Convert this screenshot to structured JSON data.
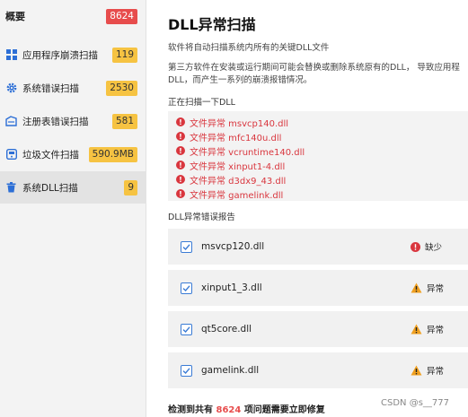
{
  "sidebar": {
    "items": [
      {
        "label": "概要",
        "badge": "8624",
        "icon": "none"
      },
      {
        "label": "应用程序崩溃扫描",
        "badge": "119",
        "icon": "app-grid-icon"
      },
      {
        "label": "系统错误扫描",
        "badge": "2530",
        "icon": "gear-icon"
      },
      {
        "label": "注册表错误扫描",
        "badge": "581",
        "icon": "registry-icon"
      },
      {
        "label": "垃圾文件扫描",
        "badge": "590.9MB",
        "icon": "disk-icon"
      },
      {
        "label": "系统DLL扫描",
        "badge": "9",
        "icon": "trash-icon"
      }
    ]
  },
  "main": {
    "title": "DLL异常扫描",
    "desc_line1": "软件将自动扫描系统内所有的关键DLL文件",
    "desc_line2": "第三方软件在安装或运行期间可能会替换或删除系统原有的DLL， 导致应用程",
    "desc_line3": "DLL，而产生一系列的崩溃报错情况。",
    "scanning_label": "正在扫描一下DLL",
    "scan_items": [
      "文件异常 msvcp140.dll",
      "文件异常 mfc140u.dll",
      "文件异常 vcruntime140.dll",
      "文件异常 xinput1-4.dll",
      "文件异常 d3dx9_43.dll",
      "文件异常 gamelink.dll"
    ],
    "report_label": "DLL异常错误报告",
    "report_rows": [
      {
        "name": "msvcp120.dll",
        "status": "缺少",
        "status_icon": "error-icon"
      },
      {
        "name": "xinput1_3.dll",
        "status": "异常",
        "status_icon": "warning-icon"
      },
      {
        "name": "qt5core.dll",
        "status": "异常",
        "status_icon": "warning-icon"
      },
      {
        "name": "gamelink.dll",
        "status": "异常",
        "status_icon": "warning-icon"
      }
    ],
    "footer_prefix": "检测到共有",
    "footer_count": "8624",
    "footer_suffix": "项问题需要立即修复"
  },
  "watermark": "CSDN @s__777",
  "colors": {
    "badge_yellow": "#f6c342",
    "badge_red": "#e74c4c",
    "error_red": "#d9363e",
    "warning_orange": "#f0a020",
    "checkbox_blue": "#3a7bd5",
    "icon_blue": "#2d6fd6"
  }
}
